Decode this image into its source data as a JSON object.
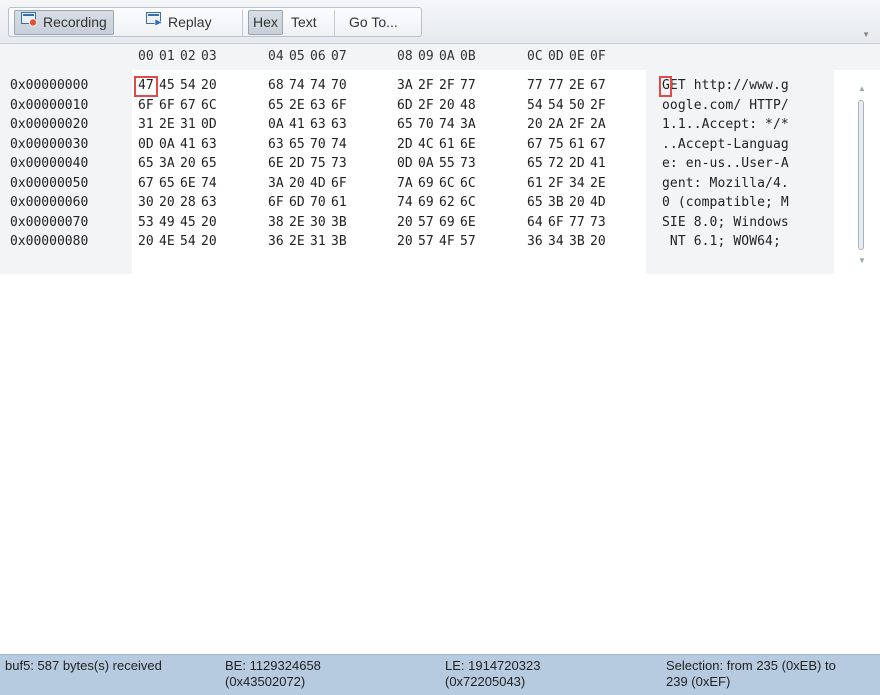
{
  "toolbar": {
    "recording_label": "Recording",
    "replay_label": "Replay",
    "hex_label": "Hex",
    "text_label": "Text",
    "goto_label": "Go To..."
  },
  "columns": [
    "00",
    "01",
    "02",
    "03",
    "04",
    "05",
    "06",
    "07",
    "08",
    "09",
    "0A",
    "0B",
    "0C",
    "0D",
    "0E",
    "0F"
  ],
  "rows": [
    {
      "offset": "0x00000000",
      "bytes": [
        "47",
        "45",
        "54",
        "20",
        "68",
        "74",
        "74",
        "70",
        "3A",
        "2F",
        "2F",
        "77",
        "77",
        "77",
        "2E",
        "67"
      ],
      "ascii": "GET http://www.g"
    },
    {
      "offset": "0x00000010",
      "bytes": [
        "6F",
        "6F",
        "67",
        "6C",
        "65",
        "2E",
        "63",
        "6F",
        "6D",
        "2F",
        "20",
        "48",
        "54",
        "54",
        "50",
        "2F"
      ],
      "ascii": "oogle.com/ HTTP/"
    },
    {
      "offset": "0x00000020",
      "bytes": [
        "31",
        "2E",
        "31",
        "0D",
        "0A",
        "41",
        "63",
        "63",
        "65",
        "70",
        "74",
        "3A",
        "20",
        "2A",
        "2F",
        "2A"
      ],
      "ascii": "1.1..Accept: */*"
    },
    {
      "offset": "0x00000030",
      "bytes": [
        "0D",
        "0A",
        "41",
        "63",
        "63",
        "65",
        "70",
        "74",
        "2D",
        "4C",
        "61",
        "6E",
        "67",
        "75",
        "61",
        "67"
      ],
      "ascii": "..Accept-Languag"
    },
    {
      "offset": "0x00000040",
      "bytes": [
        "65",
        "3A",
        "20",
        "65",
        "6E",
        "2D",
        "75",
        "73",
        "0D",
        "0A",
        "55",
        "73",
        "65",
        "72",
        "2D",
        "41"
      ],
      "ascii": "e: en-us..User-A"
    },
    {
      "offset": "0x00000050",
      "bytes": [
        "67",
        "65",
        "6E",
        "74",
        "3A",
        "20",
        "4D",
        "6F",
        "7A",
        "69",
        "6C",
        "6C",
        "61",
        "2F",
        "34",
        "2E"
      ],
      "ascii": "gent: Mozilla/4."
    },
    {
      "offset": "0x00000060",
      "bytes": [
        "30",
        "20",
        "28",
        "63",
        "6F",
        "6D",
        "70",
        "61",
        "74",
        "69",
        "62",
        "6C",
        "65",
        "3B",
        "20",
        "4D"
      ],
      "ascii": "0 (compatible; M"
    },
    {
      "offset": "0x00000070",
      "bytes": [
        "53",
        "49",
        "45",
        "20",
        "38",
        "2E",
        "30",
        "3B",
        "20",
        "57",
        "69",
        "6E",
        "64",
        "6F",
        "77",
        "73"
      ],
      "ascii": "SIE 8.0; Windows"
    },
    {
      "offset": "0x00000080",
      "bytes": [
        "20",
        "4E",
        "54",
        "20",
        "36",
        "2E",
        "31",
        "3B",
        "20",
        "57",
        "4F",
        "57",
        "36",
        "34",
        "3B",
        "20"
      ],
      "ascii": " NT 6.1; WOW64; "
    }
  ],
  "status": {
    "buffer": "buf5: 587 bytes(s) received",
    "be_line1": "BE: 1129324658",
    "be_line2": "(0x43502072)",
    "le_line1": "LE: 1914720323",
    "le_line2": "(0x72205043)",
    "selection_line1": "Selection: from 235 (0xEB) to",
    "selection_line2": "239 (0xEF)"
  },
  "colors": {
    "highlight": "#e24a4a",
    "statusbar": "#b7cbe0",
    "panel": "#f2f4f6"
  },
  "icons": [
    "recording-icon",
    "replay-icon",
    "scroll-up-icon",
    "scroll-down-icon",
    "dropdown-arrow-icon"
  ]
}
